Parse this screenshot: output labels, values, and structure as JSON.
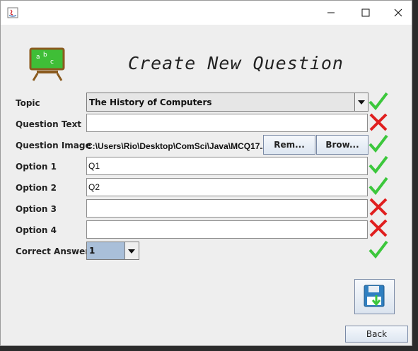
{
  "header": {
    "title": "Create New Question"
  },
  "form": {
    "topic": {
      "label": "Topic",
      "value": "The History of Computers",
      "status": "valid"
    },
    "question_text": {
      "label": "Question Text",
      "value": "",
      "status": "invalid"
    },
    "question_image": {
      "label": "Question Image",
      "path": "C:\\Users\\Rio\\Desktop\\ComSci\\Java\\MCQ17...",
      "remove_label": "Rem...",
      "browse_label": "Brow...",
      "status": "valid"
    },
    "option1": {
      "label": "Option 1",
      "value": "Q1",
      "status": "valid"
    },
    "option2": {
      "label": "Option 2",
      "value": "Q2",
      "status": "valid"
    },
    "option3": {
      "label": "Option 3",
      "value": "",
      "status": "invalid"
    },
    "option4": {
      "label": "Option 4",
      "value": "",
      "status": "invalid"
    },
    "correct_answer": {
      "label": "Correct Answer",
      "value": "1",
      "status": "valid"
    }
  },
  "actions": {
    "back_label": "Back"
  },
  "colors": {
    "valid": "#3cc73c",
    "invalid": "#e01e1e",
    "accent": "#2f7fc1"
  }
}
